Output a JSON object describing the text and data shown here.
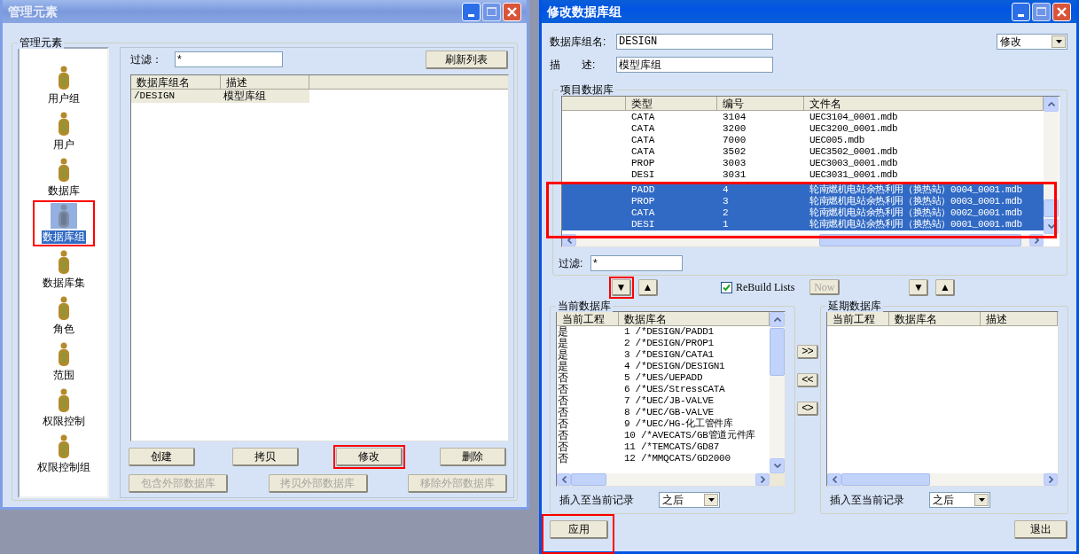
{
  "left_window": {
    "title": "管理元素",
    "active": false,
    "group_title": "管理元素",
    "sidebar_items": [
      {
        "label": "用户组",
        "selected": false,
        "marked": false
      },
      {
        "label": "用户",
        "selected": false,
        "marked": false
      },
      {
        "label": "数据库",
        "selected": false,
        "marked": false
      },
      {
        "label": "数据库组",
        "selected": true,
        "marked": true
      },
      {
        "label": "数据库集",
        "selected": false,
        "marked": false
      },
      {
        "label": "角色",
        "selected": false,
        "marked": false
      },
      {
        "label": "范围",
        "selected": false,
        "marked": false
      },
      {
        "label": "权限控制",
        "selected": false,
        "marked": false
      },
      {
        "label": "权限控制组",
        "selected": false,
        "marked": false
      }
    ],
    "filter": {
      "label": "过滤：",
      "value": "*"
    },
    "refresh_button": "刷新列表",
    "table": {
      "columns": [
        "数据库组名",
        "描述"
      ],
      "rows": [
        {
          "cells": [
            "/DESIGN",
            "模型库组"
          ],
          "selected": true
        }
      ]
    },
    "buttons": [
      {
        "label": "创建",
        "disabled": false,
        "marked": false
      },
      {
        "label": "拷贝",
        "disabled": false,
        "marked": false
      },
      {
        "label": "修改",
        "disabled": false,
        "marked": true
      },
      {
        "label": "删除",
        "disabled": false,
        "marked": false
      }
    ],
    "external_buttons": [
      {
        "label": "包含外部数据库",
        "disabled": true
      },
      {
        "label": "拷贝外部数据库",
        "disabled": true
      },
      {
        "label": "移除外部数据库",
        "disabled": true
      }
    ]
  },
  "right_window": {
    "title": "修改数据库组",
    "active": true,
    "group_name": {
      "label": "数据库组名:",
      "value": "DESIGN"
    },
    "description": {
      "label_1": "描",
      "label_2": "述:",
      "value": "模型库组"
    },
    "mode_dropdown": "修改",
    "project_db": {
      "title": "项目数据库",
      "columns": [
        "类型",
        "编号",
        "文件名"
      ],
      "selection_marked": true,
      "rows": [
        {
          "type": "CATA",
          "number": "3104",
          "file": "UEC3104_0001.mdb",
          "selected": false
        },
        {
          "type": "CATA",
          "number": "3200",
          "file": "UEC3200_0001.mdb",
          "selected": false
        },
        {
          "type": "CATA",
          "number": "7000",
          "file": "UEC005.mdb",
          "selected": false
        },
        {
          "type": "CATA",
          "number": "3502",
          "file": "UEC3502_0001.mdb",
          "selected": false
        },
        {
          "type": "PROP",
          "number": "3003",
          "file": "UEC3003_0001.mdb",
          "selected": false
        },
        {
          "type": "DESI",
          "number": "3031",
          "file": "UEC3031_0001.mdb",
          "selected": false
        },
        {
          "type": "PADD",
          "number": "4",
          "file": "轮南燃机电站余热利用（换热站）0004_0001.mdb",
          "selected": true
        },
        {
          "type": "PROP",
          "number": "3",
          "file": "轮南燃机电站余热利用（换热站）0003_0001.mdb",
          "selected": true
        },
        {
          "type": "CATA",
          "number": "2",
          "file": "轮南燃机电站余热利用（换热站）0002_0001.mdb",
          "selected": true
        },
        {
          "type": "DESI",
          "number": "1",
          "file": "轮南燃机电站余热利用（换热站）0001_0001.mdb",
          "selected": true
        }
      ],
      "filter": {
        "label": "过滤:",
        "value": "*"
      }
    },
    "move_buttons_left": [
      {
        "label": "▼",
        "marked": true
      },
      {
        "label": "▲",
        "marked": false
      }
    ],
    "rebuild": {
      "label": "ReBuild Lists",
      "checked": true
    },
    "now_button": {
      "label": "Now",
      "disabled": true
    },
    "move_buttons_right": [
      {
        "label": "▼",
        "marked": false
      },
      {
        "label": "▲",
        "marked": false
      }
    ],
    "current_db": {
      "title": "当前数据库",
      "columns": [
        "当前工程",
        "数据库名"
      ],
      "rows": [
        {
          "current": "是",
          "name": "1 /*DESIGN/PADD1"
        },
        {
          "current": "是",
          "name": "2 /*DESIGN/PROP1"
        },
        {
          "current": "是",
          "name": "3 /*DESIGN/CATA1"
        },
        {
          "current": "是",
          "name": "4 /*DESIGN/DESIGN1"
        },
        {
          "current": "否",
          "name": "5 /*UES/UEPADD"
        },
        {
          "current": "否",
          "name": "6 /*UES/StressCATA"
        },
        {
          "current": "否",
          "name": "7 /*UEC/JB-VALVE"
        },
        {
          "current": "否",
          "name": "8 /*UEC/GB-VALVE"
        },
        {
          "current": "否",
          "name": "9 /*UEC/HG-化工管件库"
        },
        {
          "current": "否",
          "name": "10 /*AVECATS/GB管道元件库"
        },
        {
          "current": "否",
          "name": "11 /*TEMCATS/GD87"
        },
        {
          "current": "否",
          "name": "12 /*MMQCATS/GD2000"
        }
      ],
      "insert_label": "插入至当前记录",
      "insert_value": "之后"
    },
    "transfer_buttons": [
      ">>",
      "<<",
      "<>"
    ],
    "deferred_db": {
      "title": "延期数据库",
      "columns": [
        "当前工程",
        "数据库名",
        "描述"
      ],
      "insert_label": "插入至当前记录",
      "insert_value": "之后"
    },
    "apply_button": {
      "label": "应用",
      "marked": true
    },
    "exit_button": "退出"
  }
}
